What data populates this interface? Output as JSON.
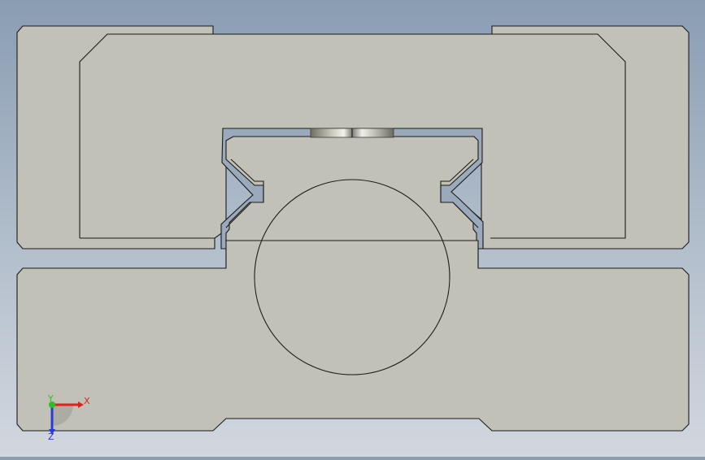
{
  "viewport": {
    "background_top": "#8a9db3",
    "background_bottom": "#d2d7df"
  },
  "model": {
    "face_color": "#c1c1b7",
    "edge_color": "#1b1b1b"
  },
  "triad": {
    "x_label": "X",
    "y_label": "Y",
    "z_label": "Z",
    "x_color": "#e0201c",
    "y_color": "#28c028",
    "z_color": "#2a3bd6"
  }
}
